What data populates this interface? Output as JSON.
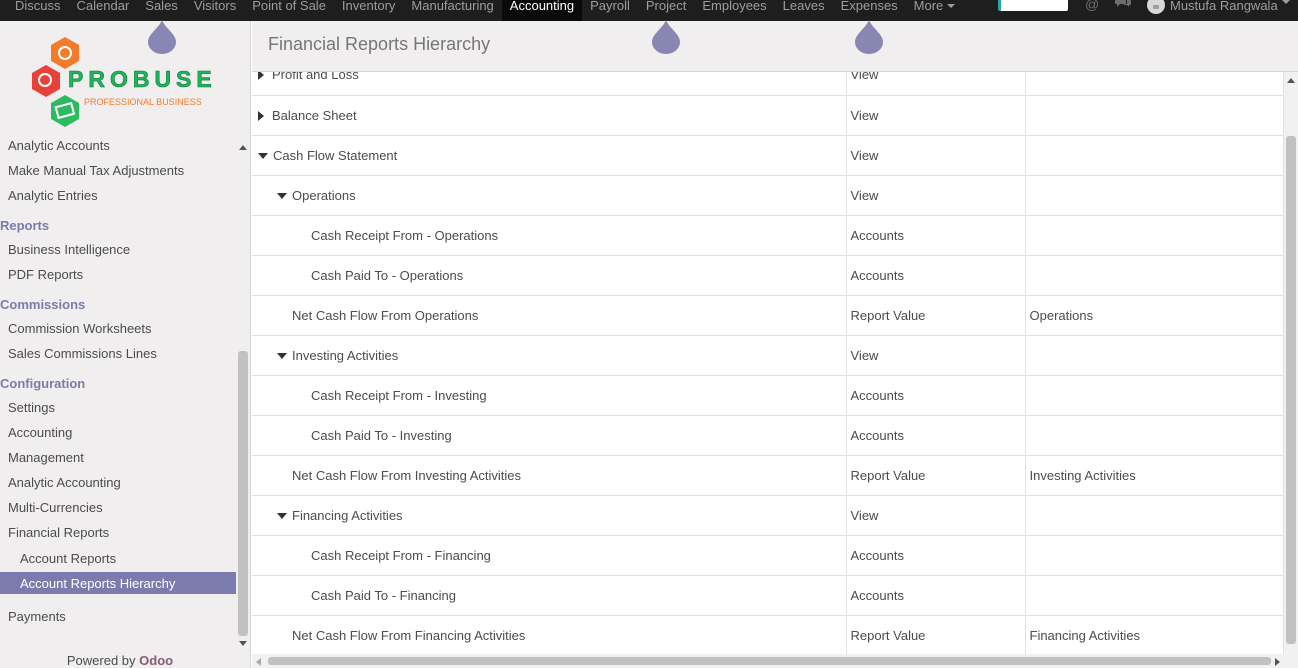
{
  "navbar": {
    "apps": [
      "Discuss",
      "Calendar",
      "Sales",
      "Visitors",
      "Point of Sale",
      "Inventory",
      "Manufacturing",
      "Accounting",
      "Payroll",
      "Project",
      "Employees",
      "Leaves",
      "Expenses"
    ],
    "active_app": "Accounting",
    "more_label": "More",
    "user_name": "Mustufa Rangwala"
  },
  "sidebar": {
    "logo_text": "PROBUSE",
    "logo_tagline": "PROFESSIONAL BUSINESS",
    "items": [
      {
        "type": "item",
        "label": "Analytic Accounts"
      },
      {
        "type": "item",
        "label": "Make Manual Tax Adjustments"
      },
      {
        "type": "item",
        "label": "Analytic Entries"
      },
      {
        "type": "header",
        "label": "Reports"
      },
      {
        "type": "item",
        "label": "Business Intelligence"
      },
      {
        "type": "item",
        "label": "PDF Reports"
      },
      {
        "type": "header",
        "label": "Commissions"
      },
      {
        "type": "item",
        "label": "Commission Worksheets"
      },
      {
        "type": "item",
        "label": "Sales Commissions Lines"
      },
      {
        "type": "header",
        "label": "Configuration"
      },
      {
        "type": "item",
        "label": "Settings"
      },
      {
        "type": "item",
        "label": "Accounting"
      },
      {
        "type": "item",
        "label": "Management"
      },
      {
        "type": "item",
        "label": "Analytic Accounting"
      },
      {
        "type": "item",
        "label": "Multi-Currencies"
      },
      {
        "type": "item",
        "label": "Financial Reports"
      },
      {
        "type": "sub",
        "label": "Account Reports"
      },
      {
        "type": "selected",
        "label": "Account Reports Hierarchy"
      },
      {
        "type": "item",
        "label": "Payments"
      }
    ],
    "powered_by": "Powered by",
    "powered_brand": "Odoo"
  },
  "page": {
    "title": "Financial Reports Hierarchy"
  },
  "table": {
    "rows": [
      {
        "name": "Profit and Loss",
        "type": "View",
        "parent": "",
        "indent": 0,
        "toggle": "collapsed"
      },
      {
        "name": "Balance Sheet",
        "type": "View",
        "parent": "",
        "indent": 0,
        "toggle": "collapsed"
      },
      {
        "name": "Cash Flow Statement",
        "type": "View",
        "parent": "",
        "indent": 0,
        "toggle": "expanded"
      },
      {
        "name": "Operations",
        "type": "View",
        "parent": "",
        "indent": 1,
        "toggle": "expanded"
      },
      {
        "name": "Cash Receipt From - Operations",
        "type": "Accounts",
        "parent": "",
        "indent": 2,
        "toggle": "none"
      },
      {
        "name": "Cash Paid To - Operations",
        "type": "Accounts",
        "parent": "",
        "indent": 2,
        "toggle": "none"
      },
      {
        "name": "Net Cash Flow From Operations",
        "type": "Report Value",
        "parent": "Operations",
        "indent": 1,
        "toggle": "none"
      },
      {
        "name": "Investing Activities",
        "type": "View",
        "parent": "",
        "indent": 1,
        "toggle": "expanded"
      },
      {
        "name": "Cash Receipt From - Investing",
        "type": "Accounts",
        "parent": "",
        "indent": 2,
        "toggle": "none"
      },
      {
        "name": "Cash Paid To - Investing",
        "type": "Accounts",
        "parent": "",
        "indent": 2,
        "toggle": "none"
      },
      {
        "name": "Net Cash Flow From Investing Activities",
        "type": "Report Value",
        "parent": "Investing Activities",
        "indent": 1,
        "toggle": "none"
      },
      {
        "name": "Financing Activities",
        "type": "View",
        "parent": "",
        "indent": 1,
        "toggle": "expanded"
      },
      {
        "name": "Cash Receipt From - Financing",
        "type": "Accounts",
        "parent": "",
        "indent": 2,
        "toggle": "none"
      },
      {
        "name": "Cash Paid To - Financing",
        "type": "Accounts",
        "parent": "",
        "indent": 2,
        "toggle": "none"
      },
      {
        "name": "Net Cash Flow From Financing Activities",
        "type": "Report Value",
        "parent": "Financing Activities",
        "indent": 1,
        "toggle": "none"
      }
    ]
  },
  "colors": {
    "navbar_bg": "#1e1e1e",
    "sidebar_bg": "#f0eeee",
    "accent": "#7c7bad",
    "odoo_brand": "#875a7b"
  }
}
